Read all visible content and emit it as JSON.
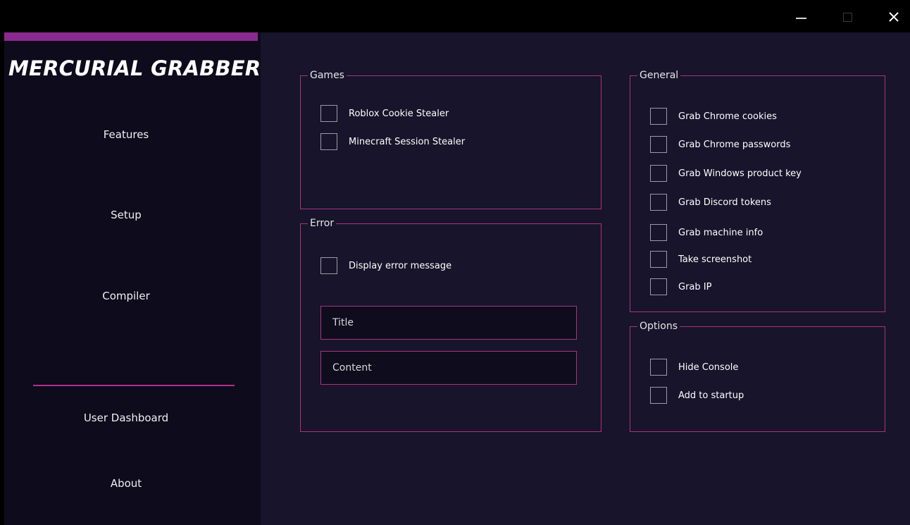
{
  "window": {
    "minimize_icon": "minimize-icon",
    "maximize_icon": "maximize-icon",
    "close_icon": "close-icon"
  },
  "colors": {
    "accent": "#a8347f",
    "sidebar_bg": "#0d0b1c",
    "main_bg": "#17142b",
    "titlebar_bg": "#000000"
  },
  "sidebar": {
    "logo": "MERCURIAL GRABBER",
    "nav": {
      "features": "Features",
      "setup": "Setup",
      "compiler": "Compiler",
      "dashboard": "User Dashboard",
      "about": "About"
    }
  },
  "games": {
    "title": "Games",
    "roblox": "Roblox Cookie Stealer",
    "minecraft": "Minecraft Session Stealer"
  },
  "error": {
    "title": "Error",
    "display": "Display error message",
    "title_placeholder": "Title",
    "content_placeholder": "Content"
  },
  "general": {
    "title": "General",
    "chrome_cookies": "Grab Chrome cookies",
    "chrome_passwords": "Grab Chrome passwords",
    "windows_key": "Grab Windows product key",
    "discord_tokens": "Grab Discord tokens",
    "machine_info": "Grab machine info",
    "screenshot": "Take screenshot",
    "ip": "Grab IP"
  },
  "options": {
    "title": "Options",
    "hide_console": "Hide Console",
    "startup": "Add to startup"
  }
}
